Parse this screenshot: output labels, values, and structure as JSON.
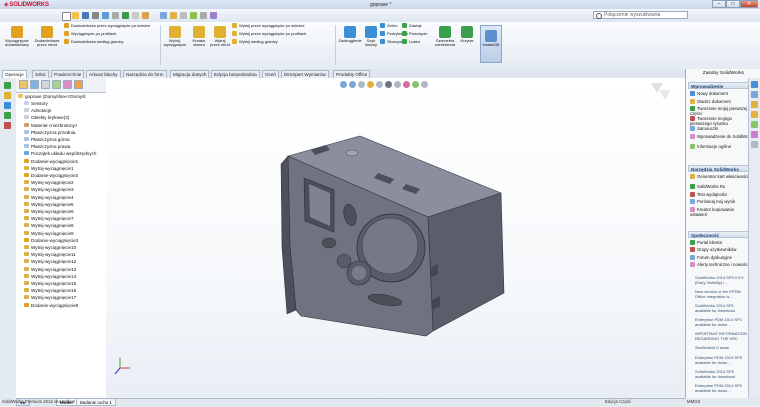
{
  "window": {
    "brand": "SOLIDWORKS",
    "title": "gopraxe *",
    "search_placeholder": "Połączenie wyszukiwania",
    "controls": [
      "min",
      "max",
      "close"
    ]
  },
  "command_manager": {
    "big_buttons": [
      {
        "label": "Wyciągnięcie dodania/bazy",
        "icon": "extrude-boss-icon",
        "color": "#e0a020"
      },
      {
        "label": "Dodanie/baza przez obrót",
        "icon": "revolve-boss-icon",
        "color": "#e0a020"
      }
    ],
    "rows_group1": [
      "Dodanie/baza przez wyciągnięcie po ścieżce",
      "Wyciągnięcie po profilach",
      "Dodanie/baza według granicy"
    ],
    "mid_buttons": [
      {
        "label": "Wytnij-wyciągnięcie",
        "icon": "extrude-cut-icon",
        "color": "#e0b030"
      },
      {
        "label": "Kreator otworu",
        "icon": "hole-wizard-icon",
        "color": "#e0b030"
      },
      {
        "label": "Wytnij przez obrót",
        "icon": "revolve-cut-icon",
        "color": "#e0b030"
      }
    ],
    "rows_group2": [
      "Wytnij przez wyciągnięcie po ścieżce",
      "Wytnij przez wyciągnięcie po profilach",
      "Wytnij według granicy"
    ],
    "feature_buttons": [
      {
        "label": "Zaokrąglenie",
        "icon": "fillet-icon",
        "color": "#3a8fd6"
      },
      {
        "label": "Szyk liniowy",
        "icon": "linear-pattern-icon",
        "color": "#3a8fd6"
      }
    ],
    "rows_group3": [
      "Żebro",
      "Podrybienie",
      "Skorupa"
    ],
    "rows_group4": [
      "Zawiąż",
      "Przecięcie",
      "Lustro"
    ],
    "ref_buttons": [
      {
        "label": "Geometria odniesienia",
        "icon": "reference-geometry-icon",
        "color": "#3aa04a"
      },
      {
        "label": "Krzywe",
        "icon": "curves-icon",
        "color": "#3aa04a"
      }
    ],
    "instant3d": "Instant3D"
  },
  "tabs": [
    "Operacje",
    "Szkic",
    "Powierzchnie",
    "Arkusz blachy",
    "Narzędzia do form",
    "Migracja danych",
    "Edycja bezpośrednia",
    "Oceń",
    "DimXpert Wymiarów",
    "Produkty Office"
  ],
  "active_tab": "Operacje",
  "tree": {
    "root": "gopraxe (Domyślna<<Domyśl",
    "items": [
      "Sensory",
      "Adnotacje",
      "Obiekty bryłowe(2)",
      "Materiał <niezbrołony>",
      "Płaszczyzna przednia",
      "Płaszczyzna górna",
      "Płaszczyzna prawa",
      "Początek układu współrzędnych",
      "Dodanie-wyciągnięcie1",
      "Wytnij-wyciągnięcie1",
      "Dodanie-wyciągnięcie2",
      "Wytnij-wyciągnięcie2",
      "Wytnij-wyciągnięcie3",
      "Wytnij-wyciągnięcie4",
      "Wytnij-wyciągnięcie5",
      "Wytnij-wyciągnięcie6",
      "Wytnij-wyciągnięcie7",
      "Wytnij-wyciągnięcie8",
      "Wytnij-wyciągnięcie9",
      "Dodanie-wyciągnięcie3",
      "Wytnij-wyciągnięcie10",
      "Wytnij-wyciągnięcie11",
      "Wytnij-wyciągnięcie12",
      "Wytnij-wyciągnięcie13",
      "Wytnij-wyciągnięcie14",
      "Wytnij-wyciągnięcie15",
      "Wytnij-wyciągnięcie16",
      "Wytnij-wyciągnięcie17",
      "Dodanie-wyciągnięcie8"
    ]
  },
  "task_pane": {
    "title": "Zasoby SolidWorks",
    "sections": [
      {
        "header": "Wprowadzenie",
        "items": [
          "Nowy dokument",
          "Otwórz dokument",
          "Tworzenie mojej pierwszej części",
          "Tworzenie mojego pierwszego rysunku",
          "Samouczki",
          "Wprowadzenie do SolidWo",
          "Informacje ogólne"
        ]
      },
      {
        "header": "Narzędzia SolidWorks",
        "items": [
          "Generator kart właściwości",
          "SolidWorks Rx",
          "Test wydajności",
          "Porównaj mój wynik",
          "Kreator kopiowania ustawień"
        ]
      },
      {
        "header": "Społeczność",
        "items": [
          "Portal klienta",
          "Grupy użytkowników",
          "Forum dyskusyjne",
          "Alerty techniczne i nowości"
        ]
      }
    ],
    "news": [
      "SolidWorks 2014 SP0.0 EV (Early Visibility) i...",
      "New version of the EPDM Office Integration is...",
      "SolidWorks 2014 SP1 available for download",
      "Enterprise PDM 2014 SP1 available for down...",
      "IMPORTANT INFORMATION REGARDING THE VRC",
      "SimWorks4.0 issue",
      "Enterprise PDM 2013 SP5 available for down...",
      "SolidWorks 2013 SP5 available for download",
      "Enterprise PDM 2014 SP0 available for down...",
      "SolidWorks 2014 SP0 available for download",
      "A Sneak Tour to Browse..."
    ]
  },
  "bottom_tabs": [
    "Model",
    "Badanie ruchu 1"
  ],
  "status": {
    "left": "SolidWorks Premium 2013 x64 Edition",
    "middle": "Edycja Część",
    "units": "MMGS"
  },
  "colors": {
    "accent": "#1d3e6e",
    "model_body": "#6b6f7f",
    "brand_red": "#c8102e"
  }
}
